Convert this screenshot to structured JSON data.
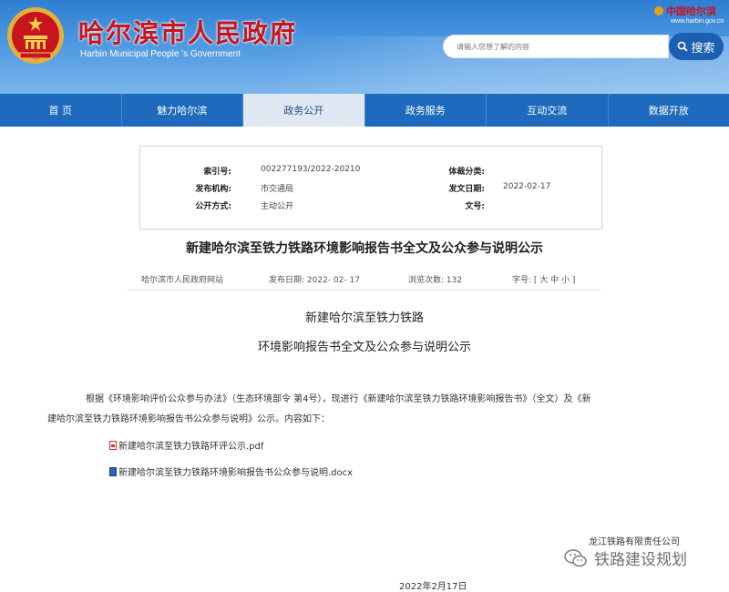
{
  "header": {
    "title_cn": "哈尔滨市人民政府",
    "title_en": "Harbin Municipal People 's Government",
    "brand_logo": "中国哈尔滨",
    "brand_url": "www.harbin.gov.cn",
    "search_placeholder": "请输入您想了解的内容",
    "search_button": "搜索"
  },
  "nav": {
    "items": [
      "首 页",
      "魅力哈尔滨",
      "政务公开",
      "政务服务",
      "互动交流",
      "数据开放"
    ],
    "active": "政务公开"
  },
  "info": {
    "index_label": "索引号:",
    "index_value": "002277193/2022-20210",
    "genre_label": "体裁分类:",
    "genre_value": "",
    "org_label": "发布机构:",
    "org_value": "市交通局",
    "date_label": "发文日期:",
    "date_value": "2022-02-17",
    "method_label": "公开方式:",
    "method_value": "主动公开",
    "docno_label": "文号:",
    "docno_value": ""
  },
  "article": {
    "title": "新建哈尔滨至铁力铁路环境影响报告书全文及公众参与说明公示",
    "source": "哈尔滨市人民政府网站",
    "publish_date": "发布日期: 2022- 02- 17",
    "views": "浏览次数:  132",
    "font_size": "字号: [ 大 中 小 ]",
    "doc_title_line1": "新建哈尔滨至铁力铁路",
    "doc_title_line2": "环境影响报告书全文及公众参与说明公示",
    "para_line1": "根据《环境影响评价公众参与办法》（生态环境部令 第4号），现进行《新建哈尔滨至铁力铁路环境影响报告书》（全文）及《新",
    "para_line2": "建哈尔滨至铁力铁路环境影响报告书公众参与说明》公示。内容如下：",
    "attachment1": "新建哈尔滨至铁力铁路环评公示.pdf",
    "attachment2": "新建哈尔滨至铁力铁路环境影响报告书公众参与说明.docx",
    "company": "龙江铁路有限责任公司",
    "date": "2022年2月17日"
  },
  "watermark": "铁路建设规划",
  "colors": {
    "nav_bg": "#1e6bbd",
    "title_red": "#c8141e",
    "search_button": "#1b5fb0"
  }
}
